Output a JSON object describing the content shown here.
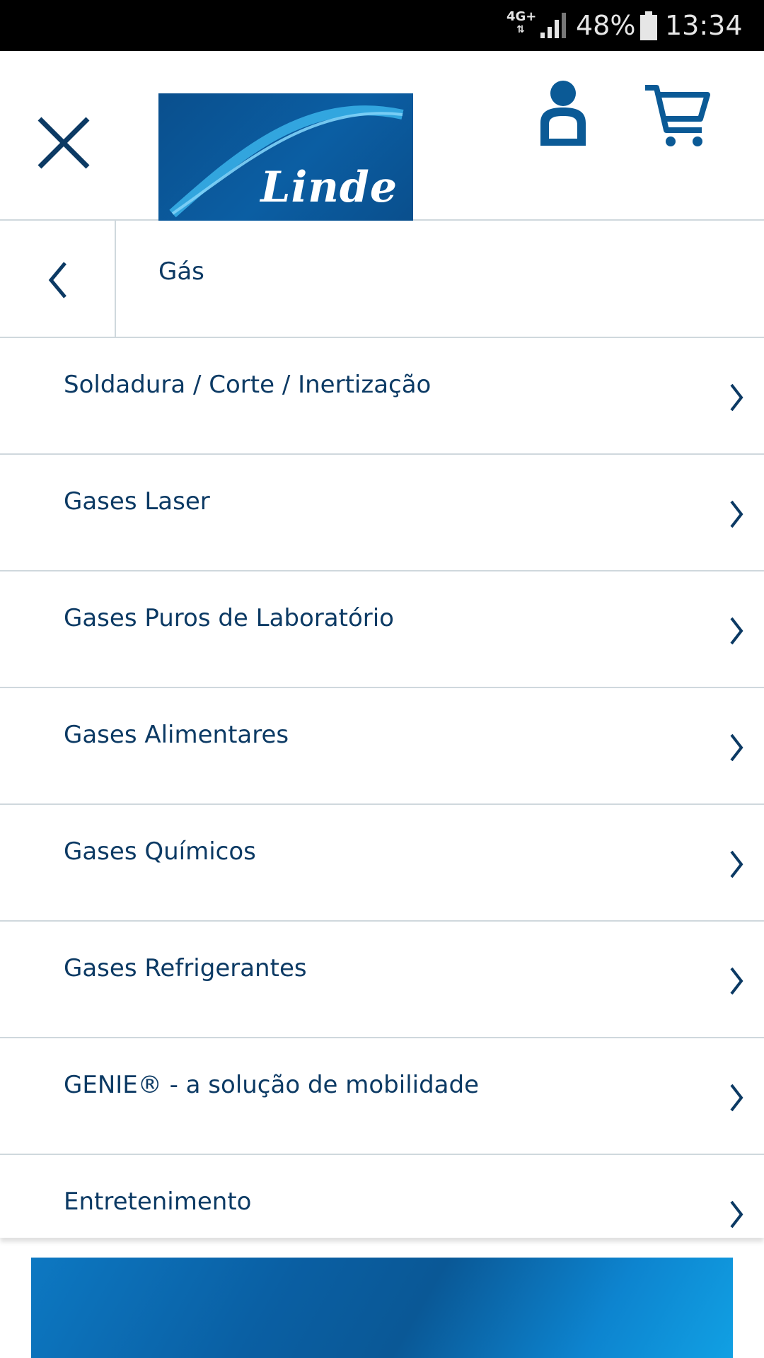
{
  "status_bar": {
    "network": "4G+",
    "network_arrows": "⇅",
    "battery_percent": "48%",
    "time": "13:34"
  },
  "header": {
    "logo_text": "Linde"
  },
  "sub_header": {
    "title": "Gás"
  },
  "menu": {
    "items": [
      {
        "label": "Soldadura / Corte / Inertização"
      },
      {
        "label": "Gases Laser"
      },
      {
        "label": "Gases Puros de Laboratório"
      },
      {
        "label": "Gases Alimentares"
      },
      {
        "label": "Gases Químicos"
      },
      {
        "label": "Gases Refrigerantes"
      },
      {
        "label": "GENIE® - a solução de mobilidade"
      },
      {
        "label": "Entretenimento"
      }
    ]
  },
  "colors": {
    "primary": "#0c3a64",
    "brand_blue": "#0b5ea3",
    "divider": "#cfd8dd"
  }
}
